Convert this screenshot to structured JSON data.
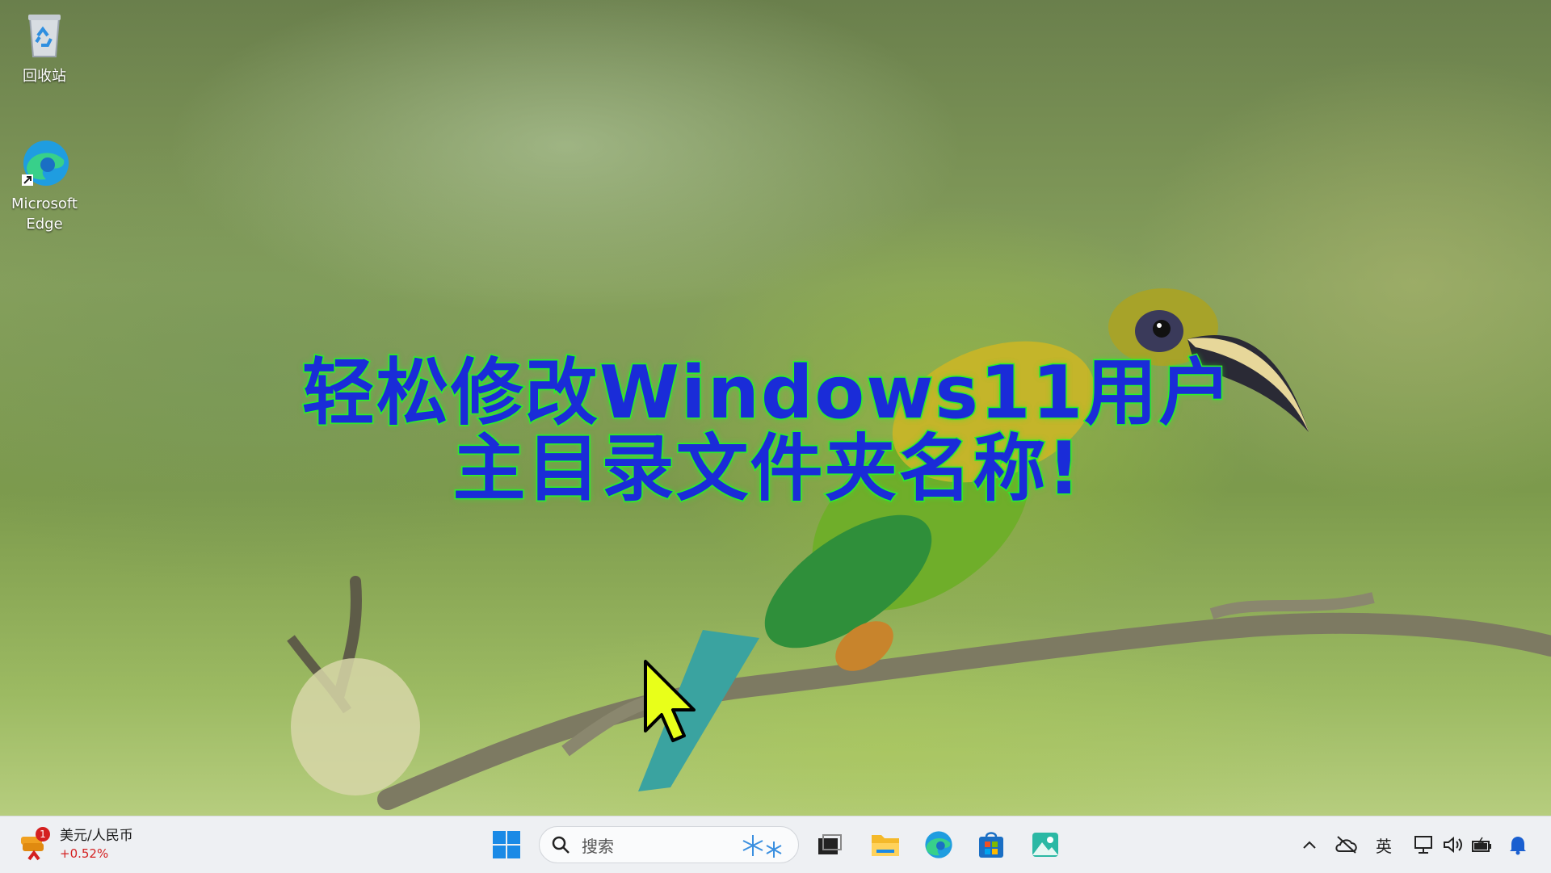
{
  "desktop": {
    "icons": [
      {
        "label": "回收站"
      },
      {
        "label": "Microsoft Edge"
      }
    ],
    "headline": {
      "line1": "轻松修改Windows11用户",
      "line2": "主目录文件夹名称!"
    }
  },
  "taskbar": {
    "widget": {
      "title": "美元/人民币",
      "value": "+0.52%",
      "badge": "1"
    },
    "search": {
      "placeholder": "搜索"
    },
    "tray": {
      "language": "英"
    }
  },
  "colors": {
    "headline_fill": "#1a2cd8",
    "headline_outline": "#2cf02c",
    "taskbar_bg": "#eef0f3",
    "badge": "#d42020"
  }
}
